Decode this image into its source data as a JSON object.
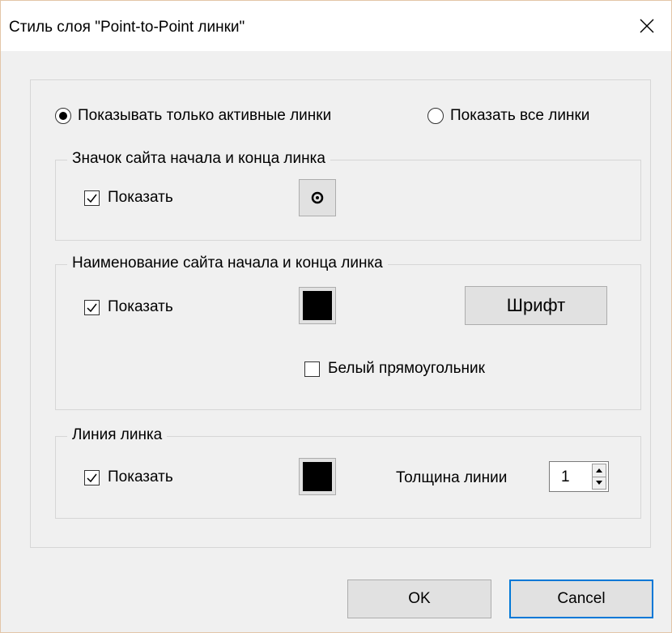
{
  "window": {
    "title": "Стиль слоя \"Point-to-Point линки\""
  },
  "display_mode": {
    "options": [
      {
        "label": "Показывать только активные линки",
        "selected": true
      },
      {
        "label": "Показать все линки",
        "selected": false
      }
    ]
  },
  "site_icon_group": {
    "title": "Значок сайта начала и конца линка",
    "show_label": "Показать",
    "show_checked": true,
    "icon": "target-circle-icon"
  },
  "site_name_group": {
    "title": "Наименование сайта начала и конца линка",
    "show_label": "Показать",
    "show_checked": true,
    "color": "#000000",
    "font_button_label": "Шрифт",
    "white_rect_label": "Белый прямоугольник",
    "white_rect_checked": false
  },
  "link_line_group": {
    "title": "Линия линка",
    "show_label": "Показать",
    "show_checked": true,
    "color": "#000000",
    "thickness_label": "Толщина линии",
    "thickness_value": "1"
  },
  "buttons": {
    "ok_label": "OK",
    "cancel_label": "Cancel"
  }
}
